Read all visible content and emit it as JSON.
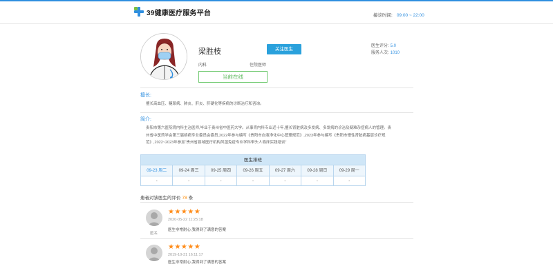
{
  "header": {
    "logo_text": "39健康医疗服务平台",
    "hours_label": "接诊时间:",
    "hours_value": "09:00 ~ 22:00"
  },
  "doctor": {
    "name": "梁胜枝",
    "follow_label": "关注医生",
    "department": "内科",
    "title": "住院医师",
    "online_label": "当前在线",
    "rating_label": "医生评分:",
    "rating_value": "5.0",
    "served_label": "服务人次:",
    "served_value": "1010"
  },
  "specialty": {
    "title": "擅长:",
    "text": "擅长高血压、糖尿病、肺炎、肝炎、肝硬化等疾病的诊断治疗和咨询。"
  },
  "intro": {
    "title": "简介:",
    "lines": [
      "贵阳市第六医院肾内科主治医师,毕业于贵州省中医药大学。从事肾内科专业近十年,擅长肾脏病及多发病、多发病的诊治及疑难杂症病人的管理。贵",
      "州省中医药学会第三届络病专业委员会委员,2022年参与编写《贵阳市血液净化中心管理规范》,2023年参与编写《贵阳市慢性肾脏病基层诊疗规",
      "范》,2022~2023年参加“贵州省县域医疗机构风湿免疫专业学科带头人临床实践培训”"
    ]
  },
  "schedule": {
    "title": "医生排班",
    "days": [
      "09-23 周二",
      "09-24 周三",
      "09-25 周四",
      "09-26 周五",
      "09-27 周六",
      "09-28 周日",
      "09-29 周一"
    ],
    "values": [
      "-",
      "-",
      "-",
      "-",
      "-",
      "-",
      "-"
    ]
  },
  "evaluations": {
    "prefix": "患者对该医生的评价",
    "count": "78",
    "suffix": "条",
    "items": [
      {
        "stars": "★★★★★",
        "date": "2020-05-22 11:25:18",
        "text": "医生非常耐心,我得到了满意的答案",
        "user": "匿名"
      },
      {
        "stars": "★★★★★",
        "date": "2019-10-31 16:11:17",
        "text": "医生非常耐心,我得到了满意的答案",
        "user": "匿名"
      }
    ]
  },
  "colors": {
    "accent": "#2f8fe0",
    "follow": "#2aa1dc",
    "online": "#5cb85c",
    "star": "#ff8c1a"
  }
}
